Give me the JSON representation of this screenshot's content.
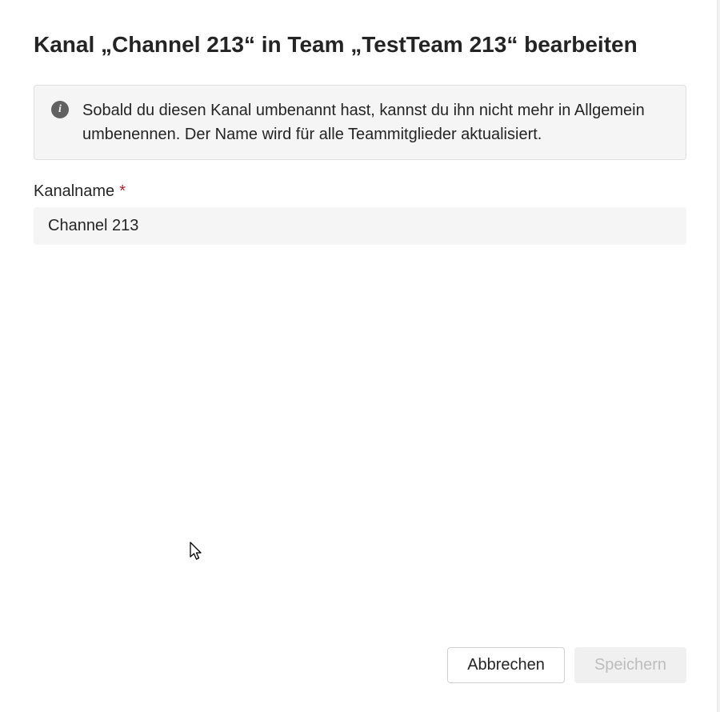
{
  "dialog": {
    "title": "Kanal „Channel 213“ in Team „TestTeam 213“ bearbeiten"
  },
  "info_banner": {
    "text": "Sobald du diesen Kanal umbenannt hast, kannst du ihn nicht mehr in Allgemein umbenennen. Der Name wird für alle Teammitglieder aktualisiert."
  },
  "form": {
    "channel_name_label": "Kanalname",
    "channel_name_value": "Channel 213"
  },
  "buttons": {
    "cancel_label": "Abbrechen",
    "save_label": "Speichern"
  }
}
